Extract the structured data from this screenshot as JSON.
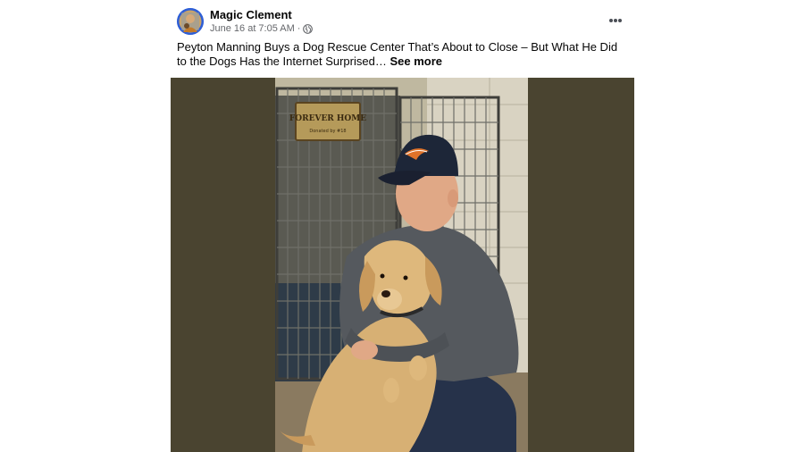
{
  "post": {
    "author": "Magic Clement",
    "timestamp": "June 16 at 7:05 AM",
    "separator": "·",
    "privacy_icon": "globe-icon",
    "more_icon": "more-options-icon",
    "caption": "Peyton Manning Buys a Dog Rescue Center That’s About to Close – But What He Did to the Dogs Has the Internet Surprised…",
    "see_more": "See more",
    "image": {
      "sign_title": "FOREVER HOME",
      "sign_subtitle": "Donated by #18"
    }
  },
  "colors": {
    "text": "#050505",
    "secondary_text": "#65676b",
    "photo_background": "#4a4430"
  }
}
